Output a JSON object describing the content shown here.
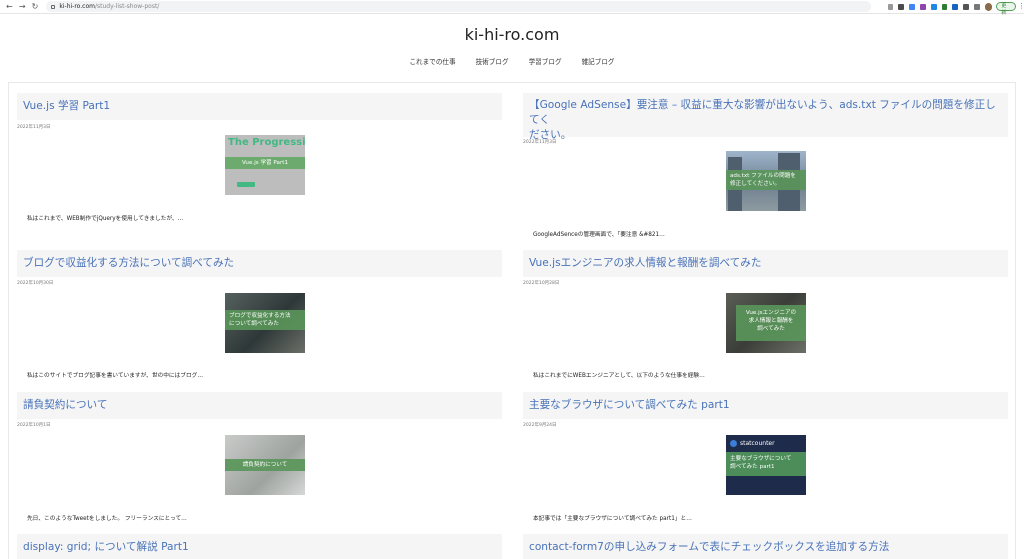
{
  "browser": {
    "url_host": "ki-hi-ro.com",
    "url_path": "/study-list-show-post/",
    "update_label": "更新",
    "ext_colors": [
      "#999999",
      "#4a4a4a",
      "#4285f4",
      "#8e44ad",
      "#1e88e5",
      "#2e7d32",
      "#1565c0",
      "#555555",
      "#777777"
    ]
  },
  "site": {
    "title": "ki-hi-ro.com",
    "menu": [
      "これまでの仕事",
      "技術ブログ",
      "学習ブログ",
      "雑記ブログ"
    ]
  },
  "posts": [
    {
      "title": "Vue.js 学習 Part1",
      "date": "2022年11月3日",
      "thumb_text": "Vue.js 学習 Part1",
      "thumb_big": "The Progressive",
      "excerpt": "私はこれまで、WEB制作でjQueryを使用してきましたが、…"
    },
    {
      "title": "【Google AdSense】要注意 – 収益に重大な影響が出ないよう、ads.txt ファイルの問題を修正してください。",
      "title_line1": "【Google AdSense】要注意 – 収益に重大な影響が出ないよう、ads.txt ファイルの問題を修正してく",
      "title_line2": "ださい。",
      "date": "2022年11月3日",
      "thumb_text": "ads.txt ファイルの問題を修正してください。",
      "thumb_line1": "ads.txt ファイルの問題を",
      "thumb_line2": "修正してください。",
      "excerpt": "GoogleAdSenceの管理画面で、「要注意 &#821…"
    },
    {
      "title": "ブログで収益化する方法について調べてみた",
      "date": "2022年10月30日",
      "thumb_line1": "ブログで収益化する方法",
      "thumb_line2": "について調べてみた",
      "excerpt": "私はこのサイトでブログ記事を書いていますが、世の中にはブログ…"
    },
    {
      "title": "Vue.jsエンジニアの求人情報と報酬を調べてみた",
      "date": "2022年10月28日",
      "thumb_line1": "Vue.jsエンジニアの",
      "thumb_line2": "求人情報と報酬を",
      "thumb_line3": "調べてみた",
      "excerpt": "私はこれまでにWEBエンジニアとして、以下のような仕事を経験…"
    },
    {
      "title": "請負契約について",
      "date": "2022年10月1日",
      "thumb_text": "請負契約について",
      "excerpt": "先日、このようなTweetをしました。 フリーランスにとって…"
    },
    {
      "title": "主要なブラウザについて調べてみた part1",
      "date": "2022年9月24日",
      "thumb_brand": "statcounter",
      "thumb_line1": "主要なブラウザについて",
      "thumb_line2": "調べてみた part1",
      "excerpt": "本記事では「主要なブラウザについて調べてみた part1」と…"
    },
    {
      "title": "display: grid; について解説 Part1"
    },
    {
      "title": "contact-form7の申し込みフォームで表にチェックボックスを追加する方法"
    }
  ]
}
